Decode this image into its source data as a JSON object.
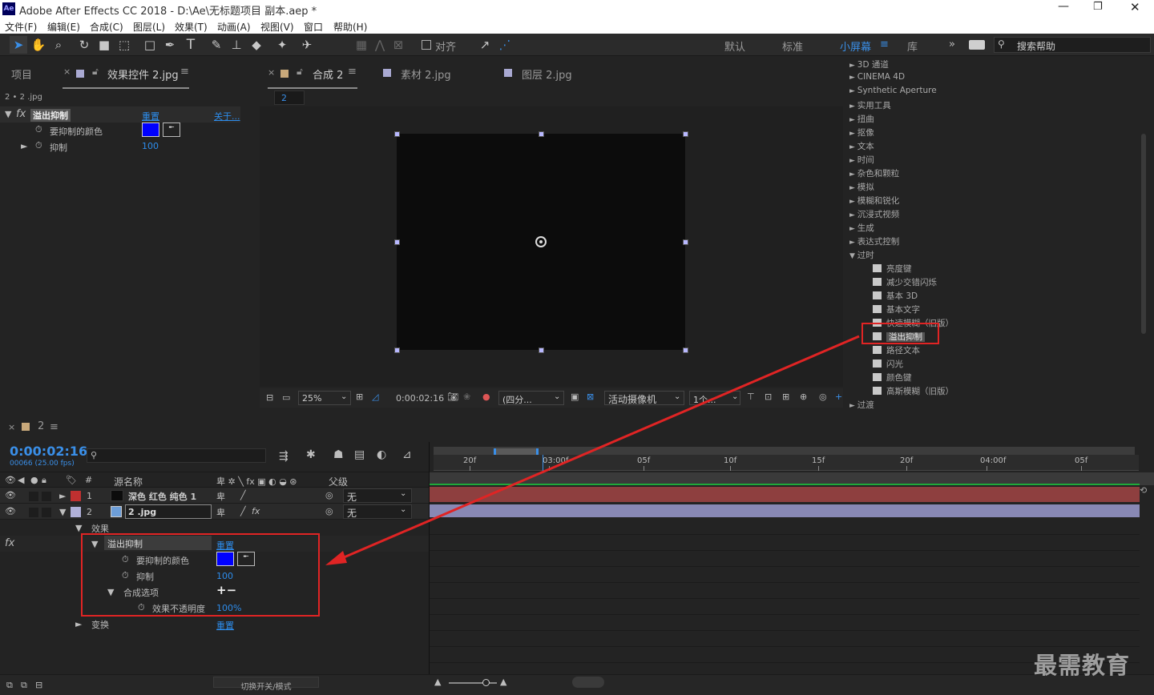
{
  "app": {
    "title": "Adobe After Effects CC 2018 - D:\\Ae\\无标题项目 副本.aep *",
    "logo": "Ae",
    "window_controls": [
      "minimize-icon",
      "restore-icon",
      "close-icon"
    ]
  },
  "menu": [
    "文件(F)",
    "编辑(E)",
    "合成(C)",
    "图层(L)",
    "效果(T)",
    "动画(A)",
    "视图(V)",
    "窗口",
    "帮助(H)"
  ],
  "toolbar": {
    "snap_label": "对齐",
    "workspaces": [
      "默认",
      "标准",
      "小屏幕",
      "库"
    ],
    "active_workspace": "小屏幕",
    "search_placeholder": "搜索帮助"
  },
  "left_panel": {
    "tab_project": "项目",
    "tab_effects": "效果控件 2.jpg",
    "layer_path": "2 • 2 .jpg",
    "effect_name": "溢出抑制",
    "reset": "重置",
    "about": "关于...",
    "prop_color": "要抑制的颜色",
    "prop_suppress": "抑制",
    "suppress_value": "100",
    "color_value": "#0000ff"
  },
  "comp_panel": {
    "tab_comp": "合成 2",
    "tab_footage": "素材 2.jpg",
    "tab_layer": "图层 2.jpg",
    "breadcrumb": "2",
    "zoom": "25%",
    "timecode": "0:00:02:16",
    "resolution": "(四分...",
    "camera": "活动摄像机",
    "views": "1个..."
  },
  "effects_panel": {
    "categories": [
      "3D 通道",
      "CINEMA 4D",
      "Synthetic Aperture",
      "实用工具",
      "扭曲",
      "抠像",
      "文本",
      "时间",
      "杂色和颗粒",
      "模拟",
      "模糊和锐化",
      "沉浸式视频",
      "生成",
      "表达式控制"
    ],
    "open_category": "过时",
    "items": [
      "亮度键",
      "减少交错闪烁",
      "基本 3D",
      "基本文字",
      "快速模糊（旧版）",
      "溢出抑制",
      "路径文本",
      "闪光",
      "颜色键",
      "高斯模糊（旧版）"
    ],
    "selected_item": "溢出抑制",
    "next_category": "过渡"
  },
  "timeline": {
    "tab": "2",
    "timecode": "0:00:02:16",
    "frames": "00066 (25.00 fps)",
    "search_placeholder": "",
    "col_num": "#",
    "col_source": "源名称",
    "col_parent": "父级",
    "ruler": [
      "20f",
      "03:00f",
      "05f",
      "10f",
      "15f",
      "20f",
      "04:00f",
      "05f"
    ],
    "layers": [
      {
        "num": "1",
        "name": "深色 红色 纯色 1",
        "parent": "无",
        "color": "#c03030"
      },
      {
        "num": "2",
        "name": "2 .jpg",
        "parent": "无",
        "color": "#b0b0d8"
      }
    ],
    "effects_group": "效果",
    "effect_name": "溢出抑制",
    "reset": "重置",
    "prop_color": "要抑制的颜色",
    "prop_suppress": "抑制",
    "suppress_value": "100",
    "composite_options": "合成选项",
    "composite_sym": "+−",
    "opacity_label": "效果不透明度",
    "opacity_value": "100%",
    "transform": "变换",
    "transform_reset": "重置",
    "toggle_label": "切换开关/模式"
  },
  "watermark": "最需教育"
}
